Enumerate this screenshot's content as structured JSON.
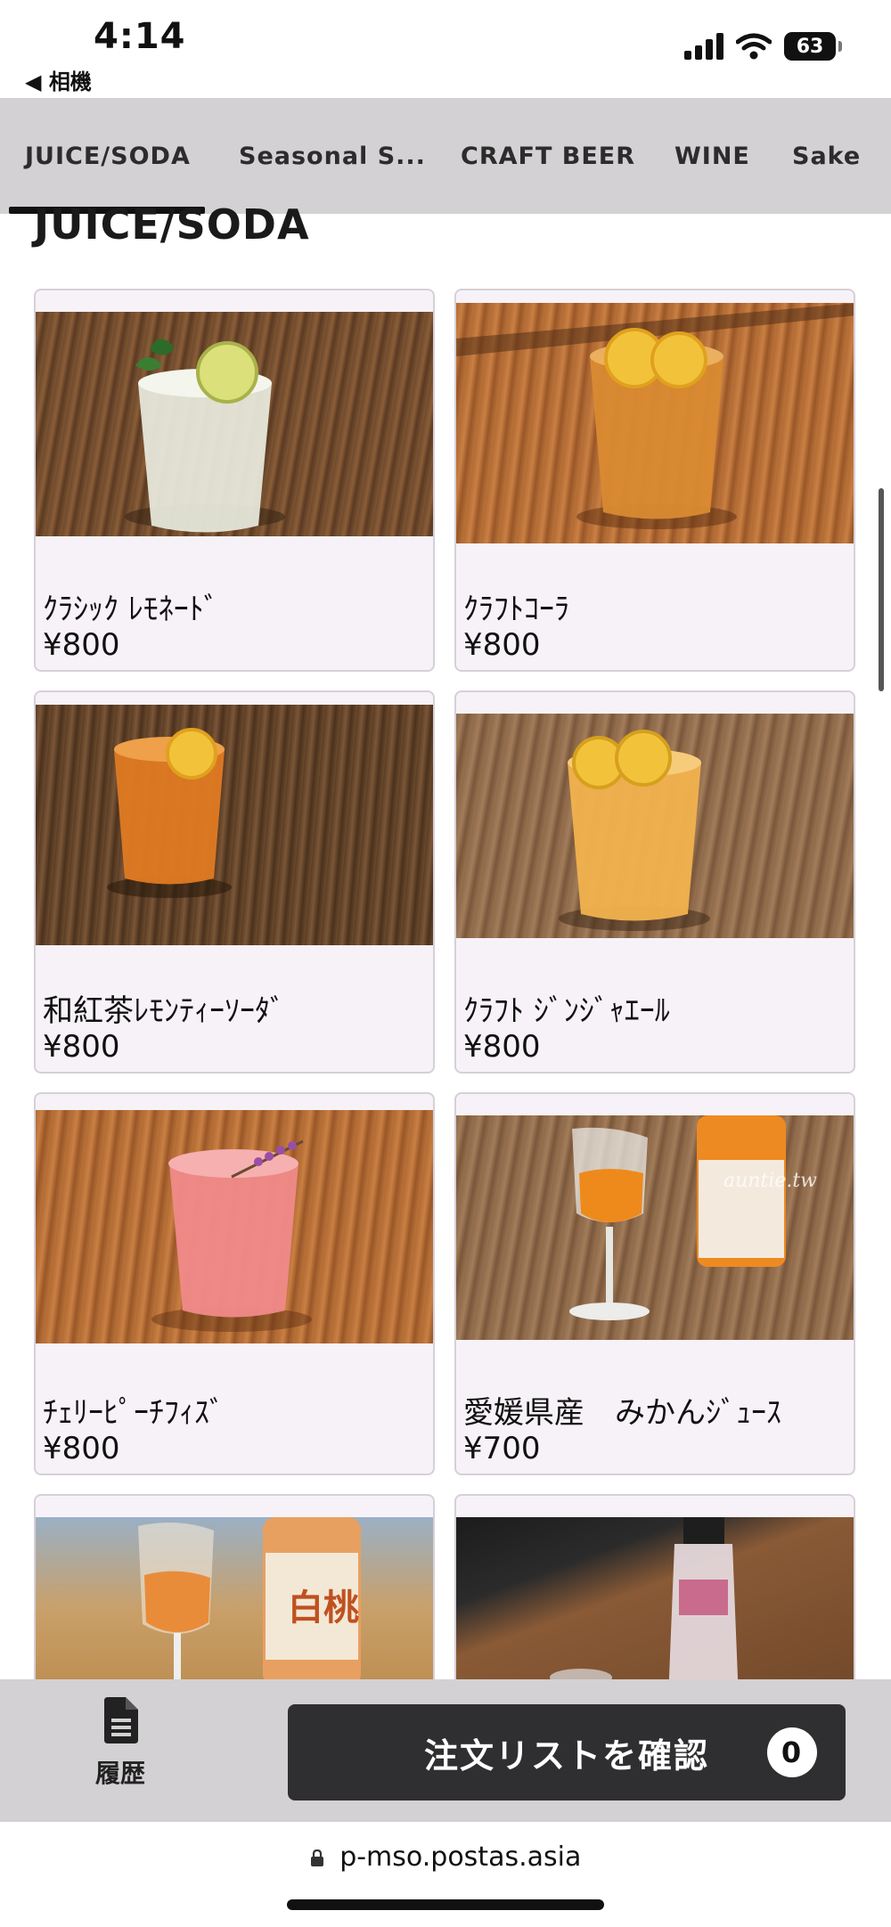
{
  "status_bar": {
    "time": "4:14",
    "back_app": "◀ 相機",
    "battery": "63"
  },
  "tabs": [
    "JUICE/SODA",
    "Seasonal S...",
    "CRAFT BEER",
    "WINE",
    "Sake"
  ],
  "section_title": "JUICE/SODA",
  "products": [
    {
      "name": "ｸﾗｼｯｸ ﾚﾓﾈｰﾄﾞ",
      "price": "¥800"
    },
    {
      "name": "ｸﾗﾌﾄｺｰﾗ",
      "price": "¥800"
    },
    {
      "name": "和紅茶ﾚﾓﾝﾃｨｰｿｰﾀﾞ",
      "price": "¥800"
    },
    {
      "name": "ｸﾗﾌﾄ ｼﾞﾝｼﾞｬｴｰﾙ",
      "price": "¥800"
    },
    {
      "name": "ﾁｪﾘｰﾋﾟｰﾁﾌｨｽﾞ",
      "price": "¥800"
    },
    {
      "name": "愛媛県産　みかんｼﾞｭｰｽ",
      "price": "¥700"
    }
  ],
  "footer": {
    "history_label": "履歴",
    "order_button_label": "注文リストを確認",
    "order_count": "0"
  },
  "url": "p-mso.postas.asia",
  "photo_text": {
    "peach_label": "白桃",
    "watermark": "auntie.tw"
  },
  "icons": {
    "lock": "lock-icon",
    "history": "document-icon",
    "wifi": "wifi-icon",
    "signal": "signal-icon",
    "battery": "battery-icon"
  }
}
